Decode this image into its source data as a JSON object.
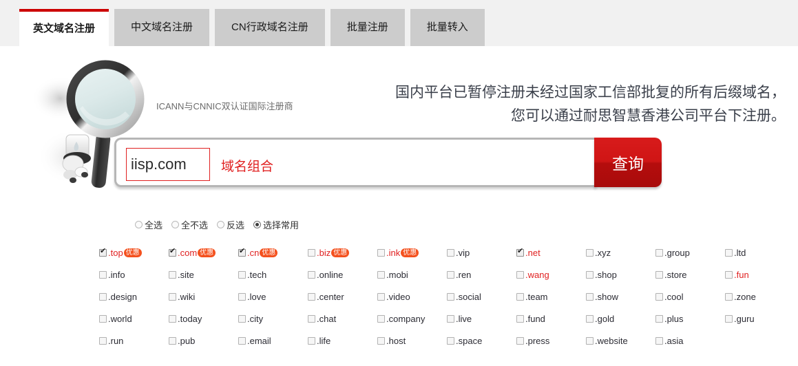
{
  "tabs": [
    {
      "label": "英文域名注册",
      "active": true
    },
    {
      "label": "中文域名注册",
      "active": false
    },
    {
      "label": "CN行政域名注册",
      "active": false
    },
    {
      "label": "批量注册",
      "active": false
    },
    {
      "label": "批量转入",
      "active": false
    }
  ],
  "branding": {
    "icann_line": "ICANN与CNNIC双认证国际注册商"
  },
  "notice": {
    "line1": "国内平台已暂停注册未经过国家工信部批复的所有后缀域名，",
    "line2": "您可以通过耐思智慧香港公司平台下注册。"
  },
  "search": {
    "value": "iisp.com",
    "placeholder": "",
    "combine_label": "域名组合",
    "button_label": "查询"
  },
  "select_modes": [
    {
      "label": "全选",
      "selected": false
    },
    {
      "label": "全不选",
      "selected": false
    },
    {
      "label": "反选",
      "selected": false
    },
    {
      "label": "选择常用",
      "selected": true
    }
  ],
  "promo_badge": "优惠",
  "colors": {
    "accent_red": "#cc0000",
    "badge_orange": "#f4511e",
    "tab_inactive": "#cccccc",
    "tab_strip": "#f1f1f1"
  },
  "suffixes": [
    {
      "label": ".top",
      "checked": true,
      "red": true,
      "promo": true
    },
    {
      "label": ".com",
      "checked": true,
      "red": true,
      "promo": true
    },
    {
      "label": ".cn",
      "checked": true,
      "red": true,
      "promo": true
    },
    {
      "label": ".biz",
      "checked": false,
      "red": true,
      "promo": true
    },
    {
      "label": ".ink",
      "checked": false,
      "red": true,
      "promo": true
    },
    {
      "label": ".vip",
      "checked": false,
      "red": false,
      "promo": false
    },
    {
      "label": ".net",
      "checked": true,
      "red": true,
      "promo": false
    },
    {
      "label": ".xyz",
      "checked": false,
      "red": false,
      "promo": false
    },
    {
      "label": ".group",
      "checked": false,
      "red": false,
      "promo": false
    },
    {
      "label": ".ltd",
      "checked": false,
      "red": false,
      "promo": false
    },
    {
      "label": ".info",
      "checked": false,
      "red": false,
      "promo": false
    },
    {
      "label": ".site",
      "checked": false,
      "red": false,
      "promo": false
    },
    {
      "label": ".tech",
      "checked": false,
      "red": false,
      "promo": false
    },
    {
      "label": ".online",
      "checked": false,
      "red": false,
      "promo": false
    },
    {
      "label": ".mobi",
      "checked": false,
      "red": false,
      "promo": false
    },
    {
      "label": ".ren",
      "checked": false,
      "red": false,
      "promo": false
    },
    {
      "label": ".wang",
      "checked": false,
      "red": true,
      "promo": false
    },
    {
      "label": ".shop",
      "checked": false,
      "red": false,
      "promo": false
    },
    {
      "label": ".store",
      "checked": false,
      "red": false,
      "promo": false
    },
    {
      "label": ".fun",
      "checked": false,
      "red": true,
      "promo": false
    },
    {
      "label": ".design",
      "checked": false,
      "red": false,
      "promo": false
    },
    {
      "label": ".wiki",
      "checked": false,
      "red": false,
      "promo": false
    },
    {
      "label": ".love",
      "checked": false,
      "red": false,
      "promo": false
    },
    {
      "label": ".center",
      "checked": false,
      "red": false,
      "promo": false
    },
    {
      "label": ".video",
      "checked": false,
      "red": false,
      "promo": false
    },
    {
      "label": ".social",
      "checked": false,
      "red": false,
      "promo": false
    },
    {
      "label": ".team",
      "checked": false,
      "red": false,
      "promo": false
    },
    {
      "label": ".show",
      "checked": false,
      "red": false,
      "promo": false
    },
    {
      "label": ".cool",
      "checked": false,
      "red": false,
      "promo": false
    },
    {
      "label": ".zone",
      "checked": false,
      "red": false,
      "promo": false
    },
    {
      "label": ".world",
      "checked": false,
      "red": false,
      "promo": false
    },
    {
      "label": ".today",
      "checked": false,
      "red": false,
      "promo": false
    },
    {
      "label": ".city",
      "checked": false,
      "red": false,
      "promo": false
    },
    {
      "label": ".chat",
      "checked": false,
      "red": false,
      "promo": false
    },
    {
      "label": ".company",
      "checked": false,
      "red": false,
      "promo": false
    },
    {
      "label": ".live",
      "checked": false,
      "red": false,
      "promo": false
    },
    {
      "label": ".fund",
      "checked": false,
      "red": false,
      "promo": false
    },
    {
      "label": ".gold",
      "checked": false,
      "red": false,
      "promo": false
    },
    {
      "label": ".plus",
      "checked": false,
      "red": false,
      "promo": false
    },
    {
      "label": ".guru",
      "checked": false,
      "red": false,
      "promo": false
    },
    {
      "label": ".run",
      "checked": false,
      "red": false,
      "promo": false
    },
    {
      "label": ".pub",
      "checked": false,
      "red": false,
      "promo": false
    },
    {
      "label": ".email",
      "checked": false,
      "red": false,
      "promo": false
    },
    {
      "label": ".life",
      "checked": false,
      "red": false,
      "promo": false
    },
    {
      "label": ".host",
      "checked": false,
      "red": false,
      "promo": false
    },
    {
      "label": ".space",
      "checked": false,
      "red": false,
      "promo": false
    },
    {
      "label": ".press",
      "checked": false,
      "red": false,
      "promo": false
    },
    {
      "label": ".website",
      "checked": false,
      "red": false,
      "promo": false
    },
    {
      "label": ".asia",
      "checked": false,
      "red": false,
      "promo": false
    }
  ]
}
